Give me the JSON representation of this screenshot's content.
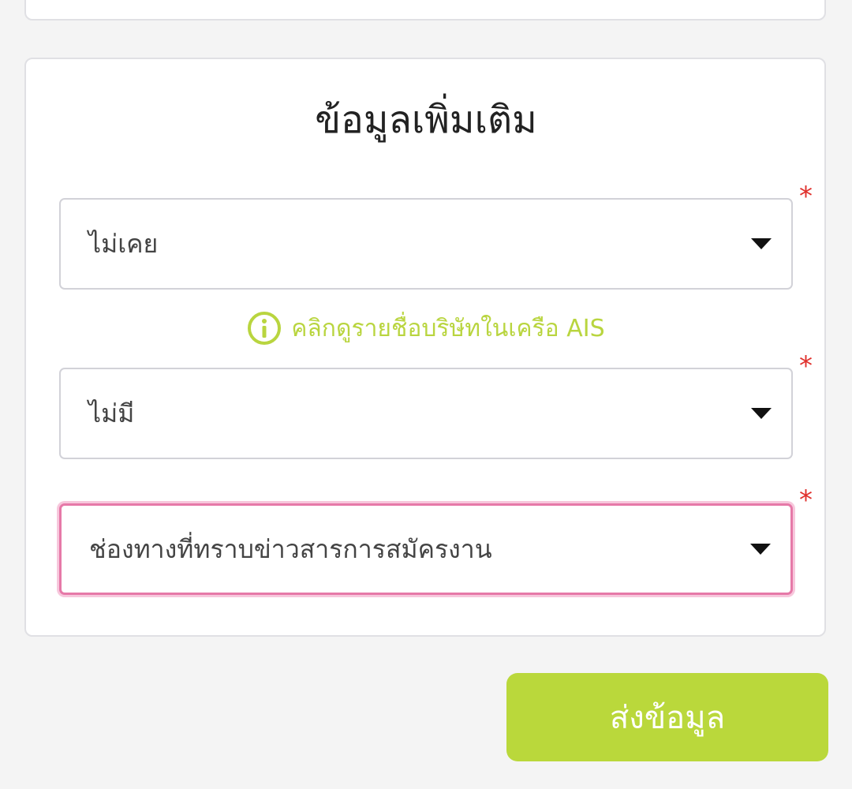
{
  "section": {
    "title": "ข้อมูลเพิ่มเติม"
  },
  "fields": [
    {
      "value": "ไม่เคย",
      "required_mark": "*"
    },
    {
      "value": "ไม่มี",
      "required_mark": "*"
    },
    {
      "value": "ช่องทางที่ทราบข่าวสารการสมัครงาน",
      "required_mark": "*"
    }
  ],
  "info_link": {
    "text": "คลิกดูรายชื่อบริษัทในเครือ AIS",
    "icon": "info-icon"
  },
  "submit": {
    "label": "ส่งข้อมูล"
  },
  "colors": {
    "accent_green": "#bad83b",
    "focus_pink": "#e679a8",
    "required_red": "#e0302c"
  }
}
